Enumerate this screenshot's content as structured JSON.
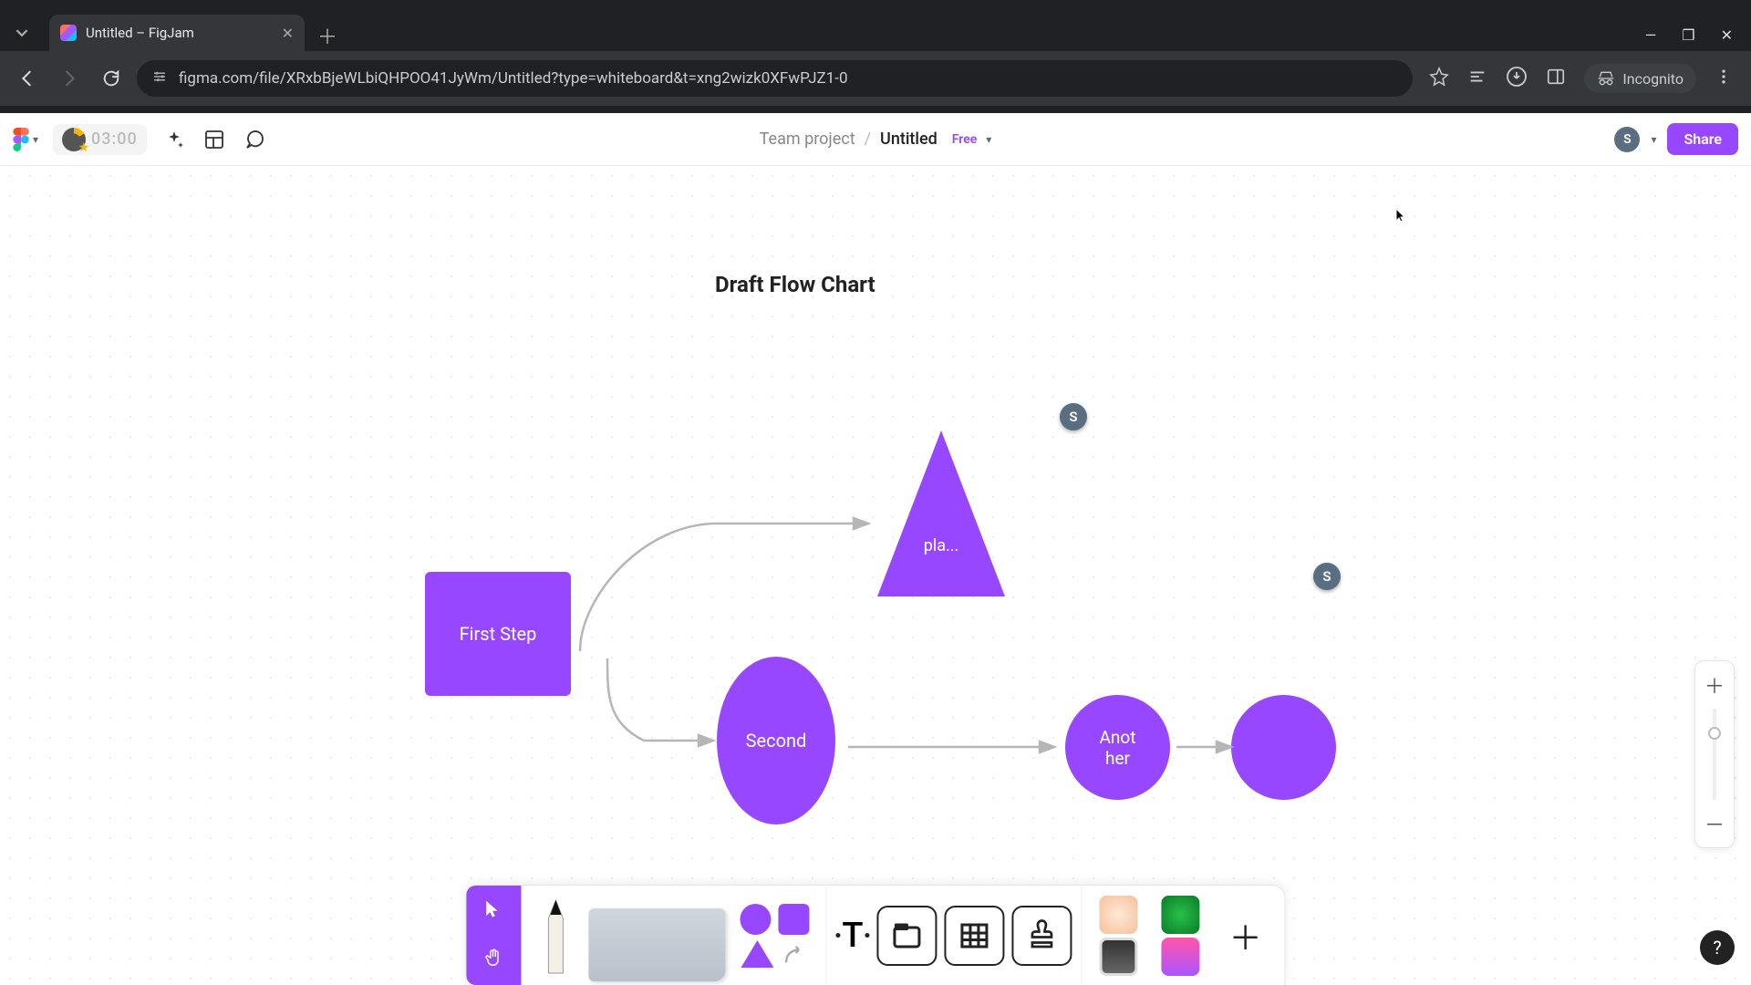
{
  "browser": {
    "tab_title": "Untitled – FigJam",
    "url": "figma.com/file/XRxbBjeWLbiQHPOO41JyWm/Untitled?type=whiteboard&t=xng2wizk0XFwPJZ1-0",
    "incognito_label": "Incognito"
  },
  "header": {
    "timer": "03:00",
    "team_name": "Team project",
    "file_name": "Untitled",
    "plan_badge": "Free",
    "avatar_letter": "S",
    "share_label": "Share"
  },
  "canvas": {
    "title": "Draft Flow Chart",
    "shapes": {
      "first_step": "First Step",
      "placeholder": "pla...",
      "second": "Second",
      "another": "Anot\nher"
    },
    "presence": {
      "p1": "S",
      "p2": "S"
    }
  },
  "help_label": "?"
}
